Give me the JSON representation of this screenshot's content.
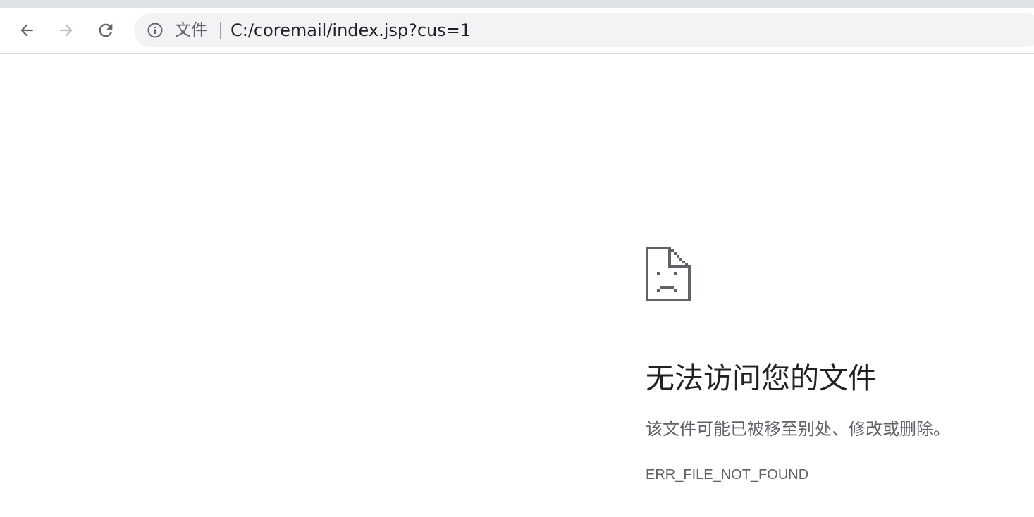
{
  "browser": {
    "omnibox": {
      "scheme_chip": "文件",
      "url": "C:/coremail/index.jsp?cus=1"
    },
    "buttons": {
      "back_icon": "arrow-left-icon",
      "forward_icon": "arrow-right-icon",
      "reload_icon": "reload-icon",
      "info_icon": "info-icon"
    }
  },
  "error_page": {
    "icon": "sad-file-icon",
    "heading": "无法访问您的文件",
    "message": "该文件可能已被移至别处、修改或删除。",
    "error_code": "ERR_FILE_NOT_FOUND"
  },
  "colors": {
    "tabstrip": "#dee1e6",
    "omnibox_bg": "#f1f3f4",
    "heading": "#202124",
    "secondary_text": "#5f6368",
    "icon": "#5f6368"
  }
}
